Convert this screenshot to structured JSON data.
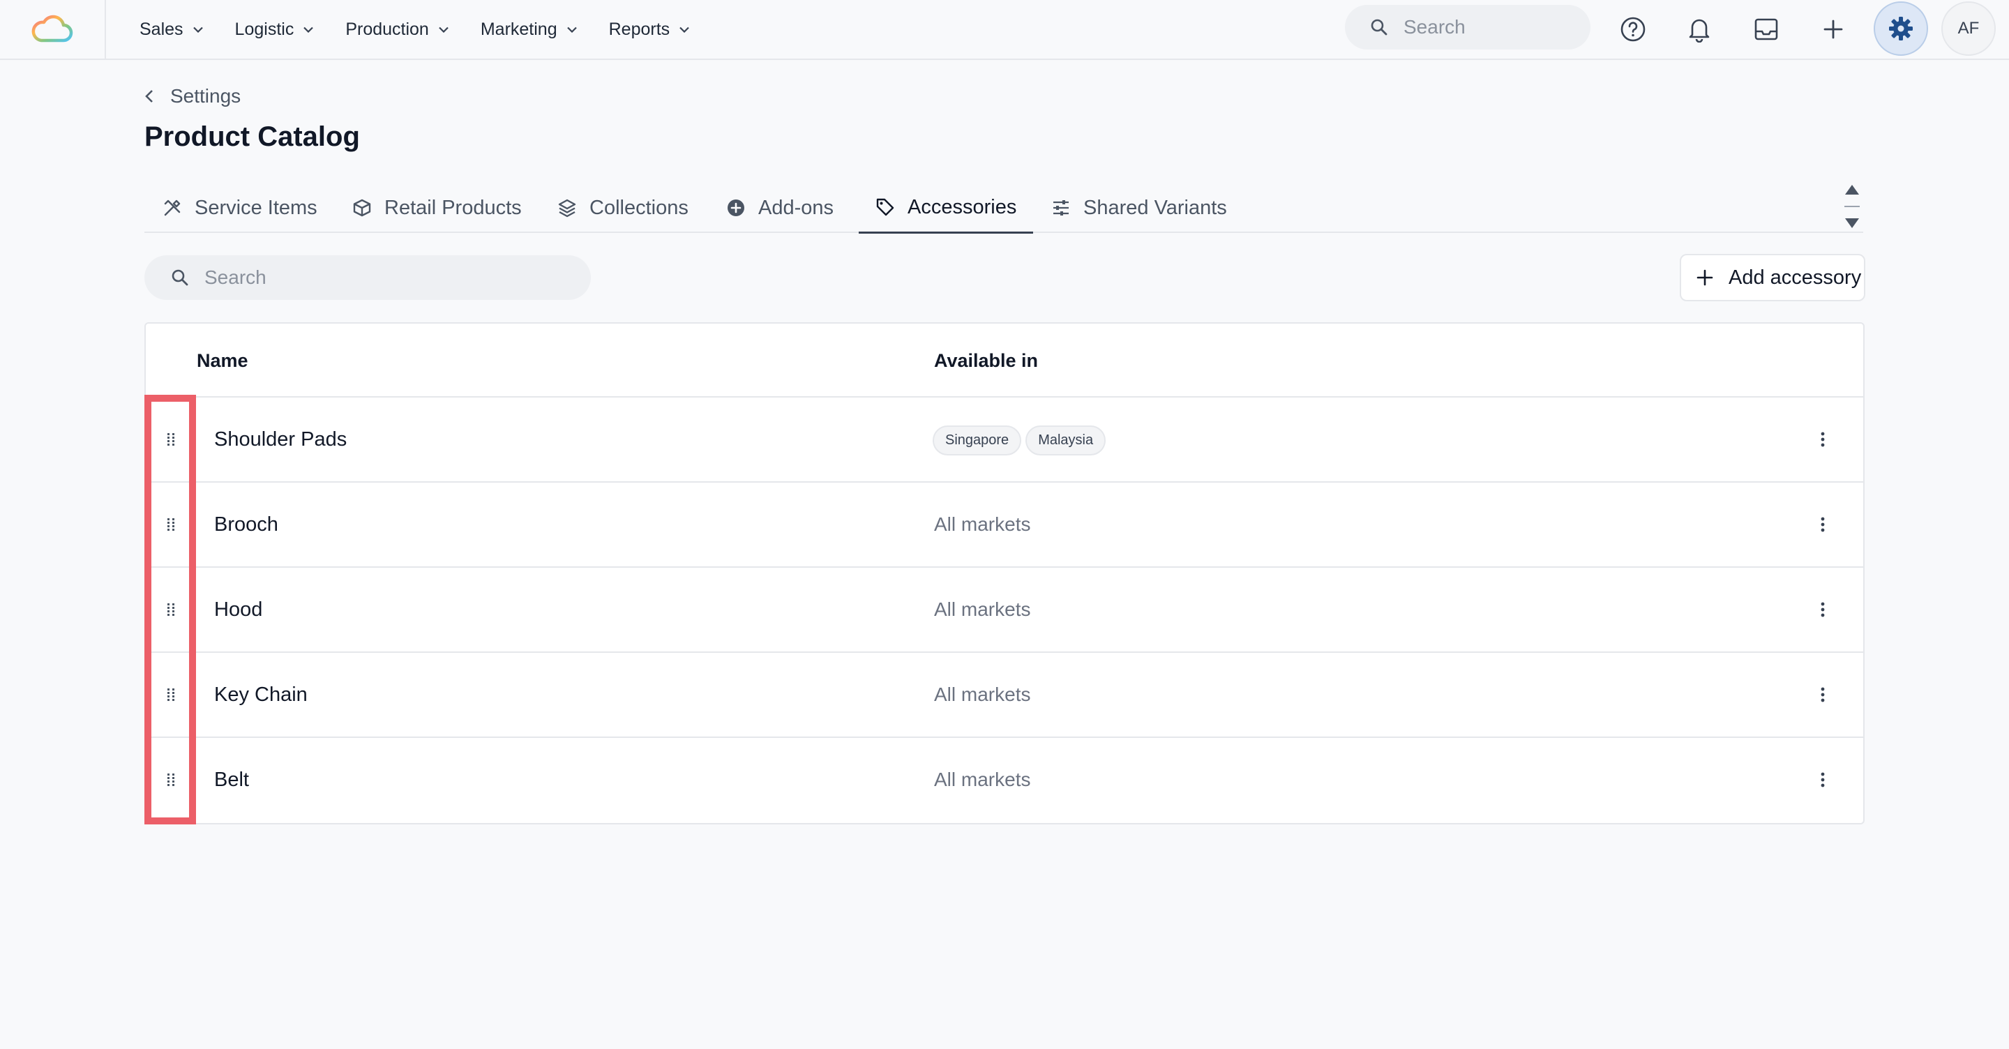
{
  "topbar": {
    "nav": [
      {
        "label": "Sales"
      },
      {
        "label": "Logistic"
      },
      {
        "label": "Production"
      },
      {
        "label": "Marketing"
      },
      {
        "label": "Reports"
      }
    ],
    "search_placeholder": "Search",
    "avatar_initials": "AF",
    "icons": [
      "help-icon",
      "bell-icon",
      "inbox-icon",
      "plus-icon",
      "gear-icon"
    ]
  },
  "header": {
    "breadcrumb": "Settings",
    "title": "Product Catalog"
  },
  "tabs": [
    {
      "label": "Service Items",
      "icon": "tools-icon"
    },
    {
      "label": "Retail Products",
      "icon": "box-icon"
    },
    {
      "label": "Collections",
      "icon": "layers-icon"
    },
    {
      "label": "Add-ons",
      "icon": "plus-circle-icon"
    },
    {
      "label": "Accessories",
      "icon": "tag-icon",
      "active": true
    },
    {
      "label": "Shared Variants",
      "icon": "sliders-icon"
    }
  ],
  "toolbar": {
    "search_placeholder": "Search",
    "add_label": "Add accessory"
  },
  "table": {
    "columns": [
      "Name",
      "Available in"
    ],
    "rows": [
      {
        "name": "Shoulder Pads",
        "available": [
          "Singapore",
          "Malaysia"
        ]
      },
      {
        "name": "Brooch",
        "available": "All markets"
      },
      {
        "name": "Hood",
        "available": "All markets"
      },
      {
        "name": "Key Chain",
        "available": "All markets"
      },
      {
        "name": "Belt",
        "available": "All markets"
      }
    ]
  },
  "colors": {
    "highlight": "#ec5f68",
    "gear_bg": "#dde7f6",
    "gear_icon": "#1f4e8c"
  }
}
